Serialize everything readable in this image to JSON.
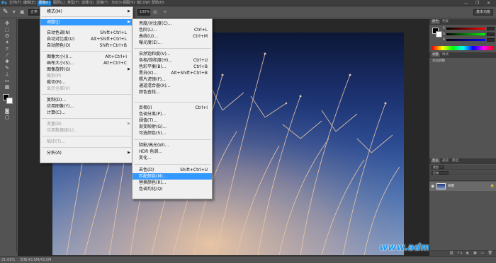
{
  "app": {
    "logo": "Ps"
  },
  "menubar": {
    "items": [
      "文件(F)",
      "编辑(E)",
      "图像(I)",
      "图层(L)",
      "类型(Y)",
      "选择(S)",
      "滤镜(T)",
      "3D(D)",
      "视图(V)",
      "窗口(W)",
      "帮助(H)"
    ],
    "window_controls": [
      "—",
      "❐",
      "✕"
    ]
  },
  "options": {
    "mode": "正常",
    "opacity": "100%",
    "workspace": "基本功能"
  },
  "image_menu": {
    "items": [
      {
        "label": "模式(M)",
        "shortcut": "",
        "submenu": true,
        "disabled": false,
        "selected": false
      },
      {
        "label": "调整(J)",
        "shortcut": "",
        "submenu": true,
        "disabled": false,
        "selected": true
      },
      {
        "label": "自动色调(N)",
        "shortcut": "Shift+Ctrl+L",
        "submenu": false,
        "disabled": false,
        "selected": false
      },
      {
        "label": "自动对比度(U)",
        "shortcut": "Alt+Shift+Ctrl+L",
        "submenu": false,
        "disabled": false,
        "selected": false
      },
      {
        "label": "自动颜色(O)",
        "shortcut": "Shift+Ctrl+B",
        "submenu": false,
        "disabled": false,
        "selected": false
      },
      {
        "label": "图像大小(I)...",
        "shortcut": "Alt+Ctrl+I",
        "submenu": false,
        "disabled": false,
        "selected": false
      },
      {
        "label": "画布大小(S)...",
        "shortcut": "Alt+Ctrl+C",
        "submenu": false,
        "disabled": false,
        "selected": false
      },
      {
        "label": "图像旋转(G)",
        "shortcut": "",
        "submenu": true,
        "disabled": false,
        "selected": false
      },
      {
        "label": "裁剪(P)",
        "shortcut": "",
        "submenu": false,
        "disabled": true,
        "selected": false
      },
      {
        "label": "裁切(R)...",
        "shortcut": "",
        "submenu": false,
        "disabled": false,
        "selected": false
      },
      {
        "label": "显示全部(V)",
        "shortcut": "",
        "submenu": false,
        "disabled": true,
        "selected": false
      },
      {
        "label": "复制(D)...",
        "shortcut": "",
        "submenu": false,
        "disabled": false,
        "selected": false
      },
      {
        "label": "应用图像(Y)...",
        "shortcut": "",
        "submenu": false,
        "disabled": false,
        "selected": false
      },
      {
        "label": "计算(C)...",
        "shortcut": "",
        "submenu": false,
        "disabled": false,
        "selected": false
      },
      {
        "label": "变量(B)",
        "shortcut": "",
        "submenu": true,
        "disabled": true,
        "selected": false
      },
      {
        "label": "应用数据组(L)...",
        "shortcut": "",
        "submenu": false,
        "disabled": true,
        "selected": false
      },
      {
        "label": "陷印(T)...",
        "shortcut": "",
        "submenu": false,
        "disabled": true,
        "selected": false
      },
      {
        "label": "分析(A)",
        "shortcut": "",
        "submenu": true,
        "disabled": false,
        "selected": false
      }
    ]
  },
  "adjust_menu": {
    "items": [
      {
        "label": "亮度/对比度(C)...",
        "shortcut": "",
        "highlighted": false
      },
      {
        "label": "色阶(L)...",
        "shortcut": "Ctrl+L",
        "highlighted": false
      },
      {
        "label": "曲线(U)...",
        "shortcut": "Ctrl+M",
        "highlighted": false
      },
      {
        "label": "曝光度(E)...",
        "shortcut": "",
        "highlighted": false
      },
      {
        "label": "自然饱和度(V)...",
        "shortcut": "",
        "highlighted": false
      },
      {
        "label": "色相/饱和度(H)...",
        "shortcut": "Ctrl+U",
        "highlighted": false
      },
      {
        "label": "色彩平衡(B)...",
        "shortcut": "Ctrl+B",
        "highlighted": false
      },
      {
        "label": "黑白(K)...",
        "shortcut": "Alt+Shift+Ctrl+B",
        "highlighted": false
      },
      {
        "label": "照片滤镜(F)...",
        "shortcut": "",
        "highlighted": false
      },
      {
        "label": "通道混合器(X)...",
        "shortcut": "",
        "highlighted": false
      },
      {
        "label": "颜色查找...",
        "shortcut": "",
        "highlighted": false
      },
      {
        "label": "反相(I)",
        "shortcut": "Ctrl+I",
        "highlighted": false
      },
      {
        "label": "色调分离(P)...",
        "shortcut": "",
        "highlighted": false
      },
      {
        "label": "阈值(T)...",
        "shortcut": "",
        "highlighted": false
      },
      {
        "label": "渐变映射(G)...",
        "shortcut": "",
        "highlighted": false
      },
      {
        "label": "可选颜色(S)...",
        "shortcut": "",
        "highlighted": false
      },
      {
        "label": "阴影/高光(W)...",
        "shortcut": "",
        "highlighted": false
      },
      {
        "label": "HDR 色调...",
        "shortcut": "",
        "highlighted": false
      },
      {
        "label": "变化...",
        "shortcut": "",
        "highlighted": false
      },
      {
        "label": "去色(D)",
        "shortcut": "Shift+Ctrl+U",
        "highlighted": false
      },
      {
        "label": "匹配颜色(M)...",
        "shortcut": "",
        "highlighted": true
      },
      {
        "label": "替换颜色(R)...",
        "shortcut": "",
        "highlighted": false
      },
      {
        "label": "色调均化(Q)",
        "shortcut": "",
        "highlighted": false
      }
    ]
  },
  "panels": {
    "color_tabs": [
      "颜色",
      "色板"
    ],
    "color_sliders": [
      "R",
      "G",
      "B"
    ],
    "adjust_tabs": [
      "调整",
      "样式"
    ],
    "adjust_title": "添加调整",
    "layer_tabs": [
      "图层",
      "通道",
      "路径"
    ],
    "layer_kind": "类型",
    "layer_blend": "正常",
    "layer_name": "背景"
  },
  "status": {
    "zoom": "21.63%",
    "doc": "文档:43.5M/43.5M"
  },
  "watermark": "www.admin365.cn",
  "colors": {
    "menu_highlight": "#3399ff",
    "menu_bg": "#f0f0f0",
    "app_bg": "#535353"
  }
}
